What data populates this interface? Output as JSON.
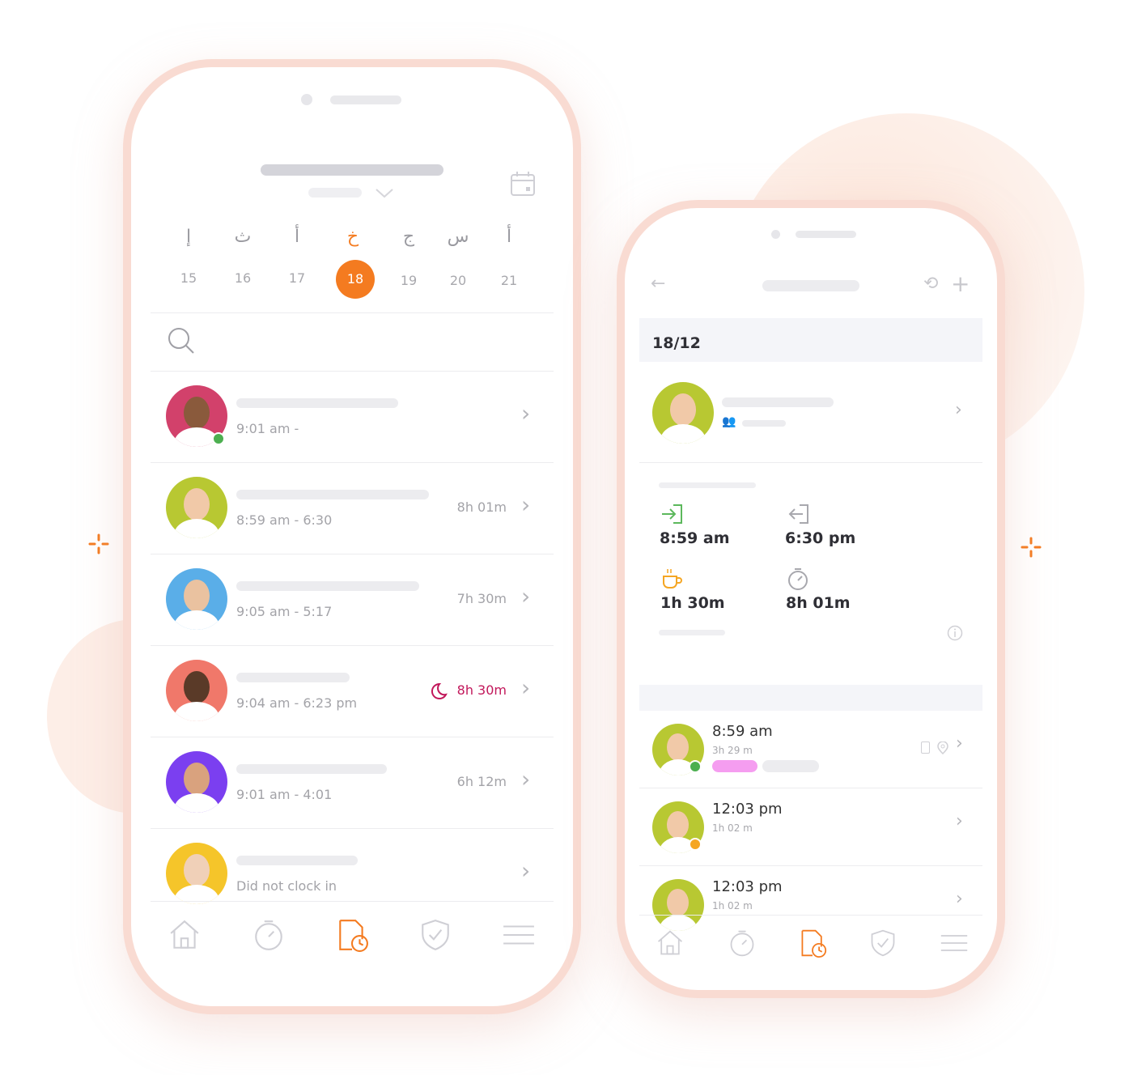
{
  "colors": {
    "accent": "#f47b20",
    "frame": "#f9dbd2",
    "online": "#4caf50",
    "break": "#f5a623",
    "night": "#c2185b",
    "tag": "#f59df0"
  },
  "left_phone": {
    "week_days": [
      {
        "letter": "إ",
        "date": "15"
      },
      {
        "letter": "ث",
        "date": "16"
      },
      {
        "letter": "أ",
        "date": "17"
      },
      {
        "letter": "خ",
        "date": "18",
        "selected": true
      },
      {
        "letter": "ج",
        "date": "19"
      },
      {
        "letter": "س",
        "date": "20"
      },
      {
        "letter": "أ",
        "date": "21"
      }
    ],
    "icons": {
      "calendar": "calendar-icon",
      "search": "search-icon"
    },
    "employees": [
      {
        "time": "9:01 am -",
        "duration": "",
        "online": true,
        "avatar_color": "#d2416b",
        "skin": "#8a5a3c"
      },
      {
        "time": "8:59 am - 6:30",
        "duration": "8h 01m",
        "avatar_color": "#b8c832",
        "skin": "#f1c9a8"
      },
      {
        "time": "9:05 am - 5:17",
        "duration": "7h 30m",
        "avatar_color": "#5aaee8",
        "skin": "#eac2a0"
      },
      {
        "time": "9:04 am - 6:23 pm",
        "duration": "8h 30m",
        "night": true,
        "avatar_color": "#f0786a",
        "skin": "#5a3a28"
      },
      {
        "time": "9:01 am - 4:01",
        "duration": "6h 12m",
        "avatar_color": "#7b3ff0",
        "skin": "#d9a27e"
      },
      {
        "time": "Did not clock in",
        "duration": "",
        "avatar_color": "#f5c52a",
        "skin": "#f0d0b8"
      }
    ],
    "nav": [
      "home-icon",
      "stopwatch-icon",
      "timesheet-icon",
      "shield-check-icon",
      "menu-icon"
    ],
    "nav_active": 2
  },
  "right_phone": {
    "date": "18/12",
    "clock_in": "8:59 am",
    "clock_out": "6:30 pm",
    "break": "1h 30m",
    "total": "8h 01m",
    "entries": [
      {
        "time": "8:59 am",
        "duration": "3h 29 m",
        "status": "#4caf50",
        "tags": true
      },
      {
        "time": "12:03 pm",
        "duration": "1h 02 m",
        "status": "#f5a623"
      },
      {
        "time": "12:03 pm",
        "duration": "1h 02 m"
      }
    ],
    "nav": [
      "home-icon",
      "stopwatch-icon",
      "timesheet-icon",
      "shield-check-icon",
      "menu-icon"
    ],
    "nav_active": 2
  }
}
